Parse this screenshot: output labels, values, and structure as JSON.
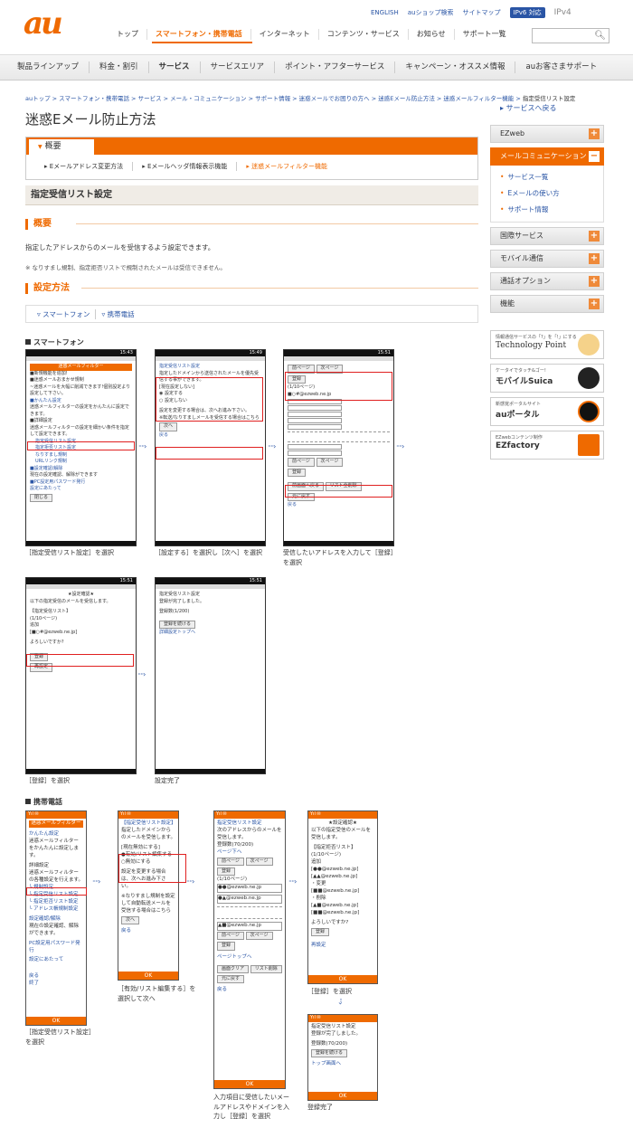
{
  "header": {
    "logo": "au",
    "utility": [
      "ENGLISH",
      "auショップ検索",
      "サイトマップ"
    ],
    "ipv6": "IPv6 対応",
    "ipv4": "IPv4",
    "topnav": [
      "トップ",
      "スマートフォン・携帯電話",
      "インターネット",
      "コンテンツ・サービス",
      "お知らせ",
      "サポート一覧"
    ],
    "subnav": [
      "製品ラインアップ",
      "料金・割引",
      "サービス",
      "サービスエリア",
      "ポイント・アフターサービス",
      "キャンペーン・オススメ情報",
      "auお客さまサポート"
    ]
  },
  "breadcrumb": {
    "path": "auトップ > スマートフォン・携帯電話 > サービス > メール・コミュニケーション > サポート情報 > 迷惑メールでお困りの方へ > 迷惑Eメール防止方法 > 迷惑メールフィルター機能 >",
    "current": "指定受信リスト設定"
  },
  "page_title": "迷惑Eメール防止方法",
  "back_link": "サービスへ戻る",
  "overview": {
    "tab": "概要",
    "links": [
      "Eメールアドレス変更方法",
      "Eメールヘッダ情報表示機能",
      "迷惑メールフィルター機能"
    ]
  },
  "section_title": "指定受信リスト設定",
  "summary": {
    "heading": "概要",
    "text": "指定したアドレスからのメールを受信するよう設定できます。",
    "note": "※ なりすまし規制、指定拒否リストで規制されたメールは受信できません。"
  },
  "method": {
    "heading": "設定方法",
    "devices": [
      "スマートフォン",
      "携帯電話"
    ]
  },
  "smartphone": {
    "title": "スマートフォン",
    "screens": [
      {
        "time": "15:43",
        "lines": [
          "迷惑メールフィルター",
          "■新規機能を追加!",
          "■迷惑メールおまかせ規制",
          "~迷惑メールを大幅に削減できます!個別設定より設定して下さい。",
          "■かんたん設定",
          "迷惑メールフィルターの設定をかんたんに設定できます。",
          "■詳細設定",
          "迷惑メールフィルターの設定を細かい条件を指定して設定できます。",
          "指定受信リスト設定",
          "指定拒否リスト設定",
          "なりすまし規制",
          "URLリンク規制",
          "■設定確認/解除",
          "現在の設定確認、解除ができます",
          "■PC設定用パスワード発行",
          "設定にあたって"
        ],
        "button": "閉じる",
        "caption": "［指定受信リスト設定］を選択"
      },
      {
        "time": "15:49",
        "lines": [
          "指定受信リスト設定",
          "指定したドメインから送信されたメールを優先受信する事ができます。",
          "[現在設定しない]",
          "設定する",
          "設定しない",
          "設定を変更する場合は、次へお進み下さい。",
          "※転送/なりすましメールを受信する場合はこちら"
        ],
        "button": "次へ",
        "link": "戻る",
        "caption": "［設定する］を選択し［次へ］を選択"
      },
      {
        "time": "15:51",
        "lines": [
          "前ページ",
          "次ページ",
          "登録",
          "(1/10ページ)",
          "■○#@ezweb.ne.jp"
        ],
        "buttons": [
          "前ページ",
          "次ページ",
          "登録",
          "前画面へ戻る",
          "リスト全削除",
          "元に戻す"
        ],
        "link": "戻る",
        "caption": "受信したいアドレスを入力して［登録］を選択"
      },
      {
        "time": "15:51",
        "lines": [
          "★設定確認★",
          "以下の指定受信のメールを受信します。",
          "【指定受信リスト】",
          "(1/10ページ)",
          "追加",
          "[■○#@ezweb.ne.jp]",
          "よろしいですか?"
        ],
        "buttons": [
          "登録",
          "再設定"
        ],
        "caption": "［登録］を選択"
      },
      {
        "time": "15:51",
        "lines": [
          "指定受信リスト設定",
          "登録が完了しました。",
          "登録数(1/200)"
        ],
        "buttons": [
          "登録を続ける"
        ],
        "link": "詳細設定トップへ",
        "caption": "設定完了"
      }
    ]
  },
  "keitai": {
    "title": "携帯電話",
    "screens": [
      {
        "header": "迷惑メールフィルター",
        "lines": [
          "かんたん設定",
          "迷惑メールフィルターをかんたんに設定します。",
          "詳細設定",
          "迷惑メールフィルターの各種設定を行えます。",
          "└ 規制設定",
          "└ 指定受信リスト設定",
          "└ 指定拒否リスト設定",
          "└ アドレス帳規制設定",
          "設定確認/解除",
          "現在の設定確認、解除ができます。",
          "PC設定用パスワード発行",
          "設定にあたって",
          "戻る",
          "終了"
        ],
        "footer": "OK",
        "caption": "［指定受信リスト設定］を選択"
      },
      {
        "header": "",
        "lines": [
          "【指定受信リスト設定】",
          "指定したドメインからのメールを受信します。",
          "[現在無効にする]",
          "●有効/リスト編集する",
          "○無効にする",
          "設定を変更する場合は、次へお進み下さい。",
          "※なりすまし規制を設定して自動転送メールを受信する場合はこちら",
          "戻る"
        ],
        "buttons": [
          "次へ"
        ],
        "footer": "OK",
        "caption": "［有効/リスト編集する］を選択して次へ"
      },
      {
        "header": "",
        "lines": [
          "指定受信リスト設定",
          "次のアドレスからのメールを受信します。",
          "登録数(70/200)",
          "ページ下へ",
          "(1/10ページ)",
          "●●@ezweb.ne.jp",
          "●▲@ezweb.ne.jp",
          "▲■@ezweb.ne.jp",
          "ページトップへ",
          "戻る"
        ],
        "buttons": [
          "前ページ",
          "次ページ",
          "登録",
          "画面クリア",
          "リスト削除",
          "元に戻す"
        ],
        "footer": "OK",
        "caption": "入力項目に受信したいメールアドレスやドメインを入力し［登録］を選択"
      },
      {
        "header": "",
        "lines": [
          "★設定確認★",
          "以下の指定受信のメールを受信します。",
          "【指定拒否リスト】",
          "(1/10ページ)",
          "追加",
          "[●●@ezweb.ne.jp]",
          "[▲▲@ezweb.ne.jp]",
          "・変更",
          "[■■@ezweb.ne.jp]",
          "・削除",
          "[▲■@ezweb.ne.jp]",
          "[■■@ezweb.ne.jp]",
          "よろしいですか?",
          "再設定"
        ],
        "buttons": [
          "登録"
        ],
        "footer": "OK",
        "caption": "［登録］を選択"
      },
      {
        "header": "",
        "lines": [
          "指定受信リスト設定",
          "登録が完了しました。",
          "登録数(70/200)",
          "トップ画面へ"
        ],
        "buttons": [
          "登録を続ける"
        ],
        "footer": "OK",
        "caption": "登録完了"
      }
    ]
  },
  "sidebar": {
    "items": [
      "EZweb",
      "メールコミュニケーション",
      "国際サービス",
      "モバイル通信",
      "通話オプション",
      "機能"
    ],
    "sub": [
      "サービス一覧",
      "Eメールの使い方",
      "サポート情報"
    ],
    "banners": [
      {
        "small": "情報通信サービスの「?」を「!」にする",
        "title": "Technology Point"
      },
      {
        "small": "ケータイでタッチ&ゴー!",
        "title": "モバイルSuica"
      },
      {
        "small": "新感覚ポータルサイト",
        "title": "auポータル"
      },
      {
        "small": "EZwebコンテンツ制作",
        "title": "EZfactory"
      }
    ]
  },
  "colors": {
    "accent": "#ef6a00",
    "link": "#2a55a5",
    "highlight": "#e02020"
  }
}
